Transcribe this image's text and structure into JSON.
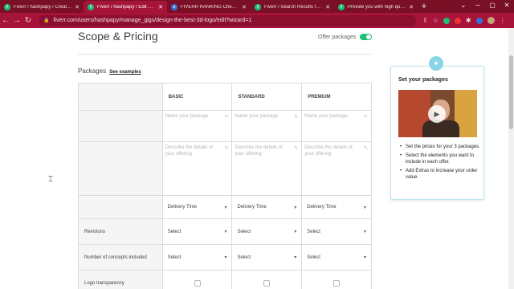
{
  "browser": {
    "tabs": [
      {
        "title": "Fiverr / hashpapy / Create a",
        "favicon": "fiverr-icon",
        "active": false
      },
      {
        "title": "Fiverr / hashpapy / Edit Gig",
        "favicon": "fiverr-icon",
        "active": true
      },
      {
        "title": "FIVERR RANKING Check list",
        "favicon": "chrome-ext-icon",
        "active": false
      },
      {
        "title": "Fiverr / Search Results for 'lo",
        "favicon": "fiverr-icon",
        "active": false
      },
      {
        "title": "Provide you with high quality",
        "favicon": "fiverr-icon",
        "active": false
      }
    ],
    "url": "fiverr.com/users/hashpapy/manage_gigs/design-the-best-3d-logo/edit?wizard=1"
  },
  "page": {
    "title": "Scope & Pricing",
    "offer_packages_label": "Offer packages",
    "offer_packages_on": true,
    "packages_heading": "Packages",
    "see_examples": "See examples"
  },
  "table": {
    "columns": [
      "BASIC",
      "STANDARD",
      "PREMIUM"
    ],
    "name_placeholder": "Name your package",
    "desc_placeholder": "Describe the details of your offering",
    "delivery_placeholder": "Delivery Time",
    "select_placeholder": "Select",
    "rows": [
      {
        "label": "Revisions",
        "type": "select"
      },
      {
        "label": "Number of concepts included",
        "type": "select"
      },
      {
        "label": "Logo transparency",
        "type": "checkbox"
      }
    ]
  },
  "side_card": {
    "title": "Set your packages",
    "tips": [
      "Set the prices for your 3 packages.",
      "Select the elements you want to include in each offer.",
      "Add Extras to increase your order value."
    ]
  },
  "colors": {
    "tab_bar": "#7a1026",
    "address_bar": "#a6143a",
    "toggle_on": "#1dbf73",
    "card_border": "#bfe5ef"
  }
}
